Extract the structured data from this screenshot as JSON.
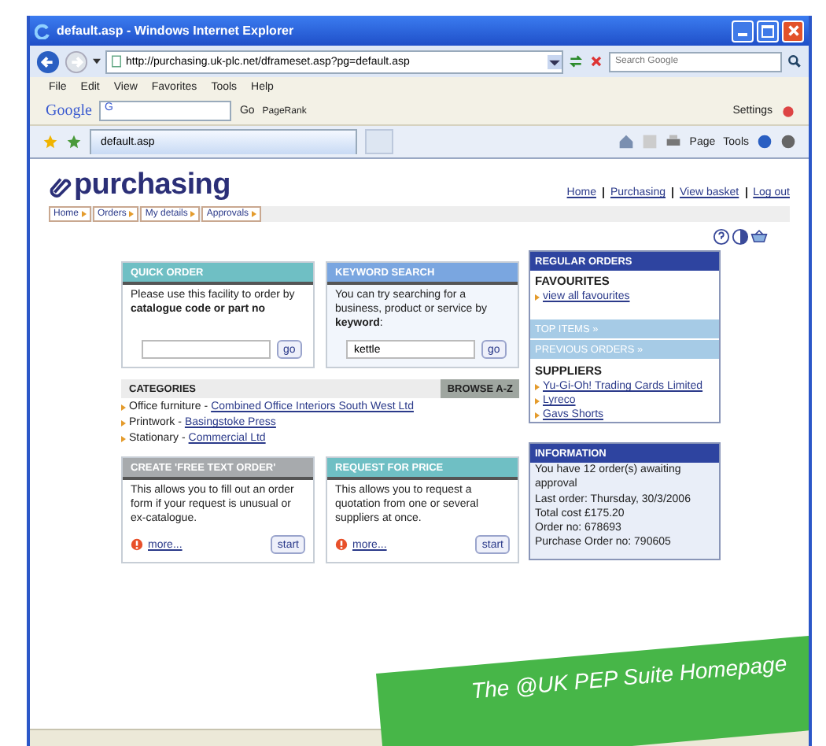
{
  "browser": {
    "title": "default.asp - Windows Internet Explorer",
    "address": "http://purchasing.uk-plc.net/dframeset.asp?pg=default.asp",
    "search_placeholder": "Search Google",
    "menu": [
      "File",
      "Edit",
      "View",
      "Favorites",
      "Tools",
      "Help"
    ],
    "google_toolbar": {
      "logo": "Google",
      "field_prefix": "G",
      "go": "Go",
      "pagerank": "PageRank",
      "settings": "Settings"
    },
    "tab": "default.asp",
    "commands": {
      "page": "Page",
      "tools": "Tools"
    }
  },
  "page": {
    "logo": "purchasing",
    "nav_tabs": [
      "Home",
      "Orders",
      "My details",
      "Approvals"
    ],
    "top_links": [
      "Home",
      "Purchasing",
      "View basket",
      "Log out"
    ],
    "quick_order": {
      "title": "QUICK ORDER",
      "text": "Please use this facility to order by **catalogue code or part no**",
      "button": "go"
    },
    "keyword_search": {
      "title": "KEYWORD SEARCH",
      "text": "You can try searching for a business, product or service by **keyword**:",
      "value": "kettle",
      "button": "go"
    },
    "categories": {
      "title": "CATEGORIES",
      "browse": "BROWSE A-Z",
      "items": [
        {
          "category": "Office furniture -",
          "supplier": "Combined Office Interiors South West Ltd"
        },
        {
          "category": "Printwork -",
          "supplier": "Basingstoke Press"
        },
        {
          "category": "Stationary -",
          "supplier": "Commercial Ltd"
        }
      ]
    },
    "free_text_order": {
      "title": "CREATE 'FREE TEXT ORDER'",
      "text": "This allows you to fill out an order form if your request is unusual or ex-catalogue.",
      "more": "more...",
      "button": "start"
    },
    "request_for_price": {
      "title": "REQUEST FOR PRICE",
      "text": "This allows you to request a quotation from one or several suppliers at once.",
      "more": "more...",
      "button": "start"
    },
    "regular_orders": {
      "title": "REGULAR ORDERS",
      "favourites": "FAVOURITES",
      "favourites_link": "view all favourites",
      "top_items": "TOP ITEMS »",
      "previous_orders": "PREVIOUS ORDERS »",
      "suppliers_heading": "SUPPLIERS",
      "suppliers": [
        "Yu-Gi-Oh! Trading Cards Limited",
        "Lyreco",
        "Gavs Shorts"
      ]
    },
    "information": {
      "title": "INFORMATION",
      "lines": [
        "You have 12 order(s) awaiting approval",
        "Last order: Thursday, 30/3/2006",
        "Total cost £175.20",
        "Order no: 678693",
        "Purchase Order no: 790605"
      ]
    }
  },
  "caption": "The @UK PEP Suite Homepage"
}
